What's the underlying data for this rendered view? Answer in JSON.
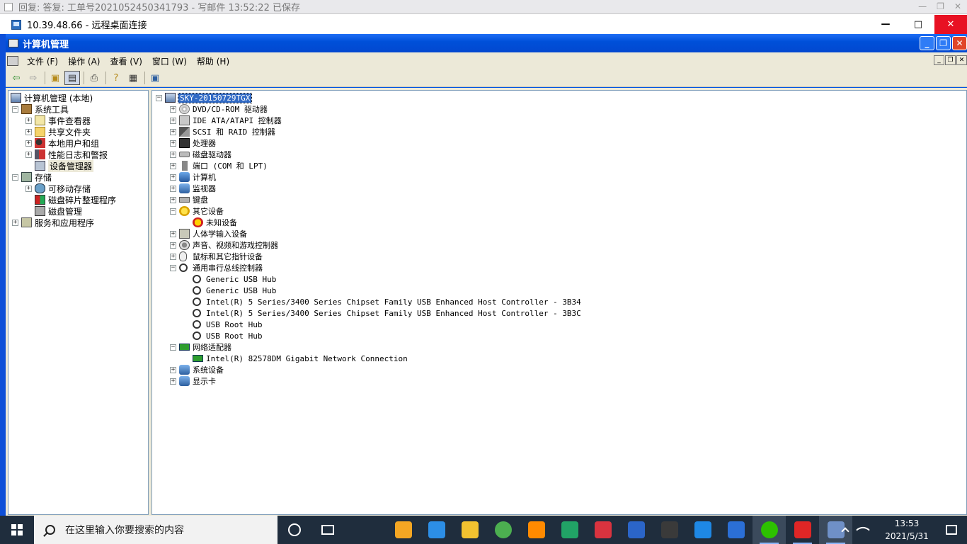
{
  "mail_window": {
    "title": "回复: 答复: 工单号2021052450341793 - 写邮件   13:52:22 已保存"
  },
  "rdp": {
    "title": "10.39.48.66 - 远程桌面连接",
    "min": "—",
    "max": "□",
    "close": "✕"
  },
  "cm": {
    "title": "计算机管理",
    "menu": [
      "文件 (F)",
      "操作 (A)",
      "查看 (V)",
      "窗口 (W)",
      "帮助 (H)"
    ],
    "toolbar_icons": [
      "back-icon",
      "forward-icon",
      "up-folder-icon",
      "show-hide-tree-icon",
      "print-icon",
      "help-icon",
      "properties-icon",
      "device-scan-icon"
    ]
  },
  "left_tree": [
    {
      "label": "计算机管理 (本地)",
      "icon": "computer-management-icon"
    },
    {
      "label": "系统工具",
      "icon": "system-tools-icon"
    },
    {
      "label": "事件查看器",
      "icon": "event-viewer-icon"
    },
    {
      "label": "共享文件夹",
      "icon": "shared-folders-icon"
    },
    {
      "label": "本地用户和组",
      "icon": "local-users-icon"
    },
    {
      "label": "性能日志和警报",
      "icon": "performance-logs-icon"
    },
    {
      "label": "设备管理器",
      "icon": "device-manager-icon"
    },
    {
      "label": "存储",
      "icon": "storage-icon"
    },
    {
      "label": "可移动存储",
      "icon": "removable-storage-icon"
    },
    {
      "label": "磁盘碎片整理程序",
      "icon": "defrag-icon"
    },
    {
      "label": "磁盘管理",
      "icon": "disk-management-icon"
    },
    {
      "label": "服务和应用程序",
      "icon": "services-apps-icon"
    }
  ],
  "right_tree": [
    {
      "label": "SKY-20150729TGX"
    },
    {
      "label": "DVD/CD-ROM 驱动器"
    },
    {
      "label": "IDE ATA/ATAPI 控制器"
    },
    {
      "label": "SCSI 和 RAID 控制器"
    },
    {
      "label": "处理器"
    },
    {
      "label": "磁盘驱动器"
    },
    {
      "label": "端口 (COM 和 LPT)"
    },
    {
      "label": "计算机"
    },
    {
      "label": "监视器"
    },
    {
      "label": "键盘"
    },
    {
      "label": "其它设备"
    },
    {
      "label": "未知设备"
    },
    {
      "label": "人体学输入设备"
    },
    {
      "label": "声音、视频和游戏控制器"
    },
    {
      "label": "鼠标和其它指针设备"
    },
    {
      "label": "通用串行总线控制器"
    },
    {
      "label": "Generic USB Hub"
    },
    {
      "label": "Generic USB Hub"
    },
    {
      "label": "Intel(R) 5 Series/3400 Series Chipset Family USB Enhanced Host Controller - 3B34"
    },
    {
      "label": "Intel(R) 5 Series/3400 Series Chipset Family USB Enhanced Host Controller - 3B3C"
    },
    {
      "label": "USB Root Hub"
    },
    {
      "label": "USB Root Hub"
    },
    {
      "label": "网络适配器"
    },
    {
      "label": "Intel(R) 82578DM Gigabit Network Connection"
    },
    {
      "label": "系统设备"
    },
    {
      "label": "显示卡"
    }
  ],
  "taskbar": {
    "search_placeholder": "在这里输入你要搜索的内容",
    "time": "13:53",
    "date": "2021/5/31",
    "apps": [
      "store-icon",
      "mail-icon",
      "file-explorer-icon",
      "chrome-icon",
      "search-tool-icon",
      "spreadsheet-icon",
      "music-icon",
      "visio-icon",
      "terminal-icon",
      "ie-icon",
      "word-icon",
      "wechat-icon",
      "app-red-icon",
      "remote-desktop-icon"
    ],
    "app_colors": [
      "#f4a623",
      "#2c8ee6",
      "#f2c230",
      "#4caf50",
      "#ff8a00",
      "#21a366",
      "#d9333f",
      "#2b65c8",
      "#3a3a3a",
      "#1e88e5",
      "#2b6fd6",
      "#2dc100",
      "#e02626",
      "#6f90c7"
    ]
  }
}
